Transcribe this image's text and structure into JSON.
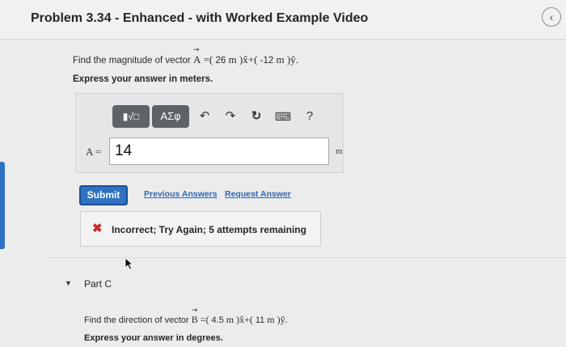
{
  "header": {
    "title": "Problem 3.34 - Enhanced - with Worked Example Video",
    "back_icon": "‹"
  },
  "partB": {
    "prompt_prefix": "Find the magnitude of vector ",
    "vector": "A",
    "equals": " =( ",
    "x_component": "26",
    "unit_x": " m )x̂+( ",
    "y_component": "-12",
    "unit_y": " m )ŷ.",
    "instruction": "Express your answer in meters.",
    "toolbar": {
      "templates_glyph": "▮√□",
      "greek_glyph": "ΑΣφ",
      "undo_glyph": "↶",
      "redo_glyph": "↷",
      "reset_glyph": "↻",
      "keyboard_glyph": "⌨",
      "help_glyph": "?"
    },
    "answer_label": "A =",
    "answer_value": "14",
    "answer_unit": "m",
    "submit_label": "Submit",
    "previous_answers_label": "Previous Answers",
    "request_answer_label": "Request Answer",
    "feedback_icon": "✖",
    "feedback_text": "Incorrect; Try Again; 5 attempts remaining"
  },
  "partC": {
    "caret": "▼",
    "label": "Part C",
    "prompt_prefix": "Find the direction of vector ",
    "vector": "B",
    "equals": " =( ",
    "x_component": "4.5",
    "unit_x": " m )x̂+( ",
    "y_component": "11",
    "unit_y": " m )ŷ.",
    "instruction": "Express your answer in degrees."
  },
  "colors": {
    "accent": "#2f72c4",
    "error": "#c8302e",
    "toolbar_bg": "#5f6368"
  }
}
